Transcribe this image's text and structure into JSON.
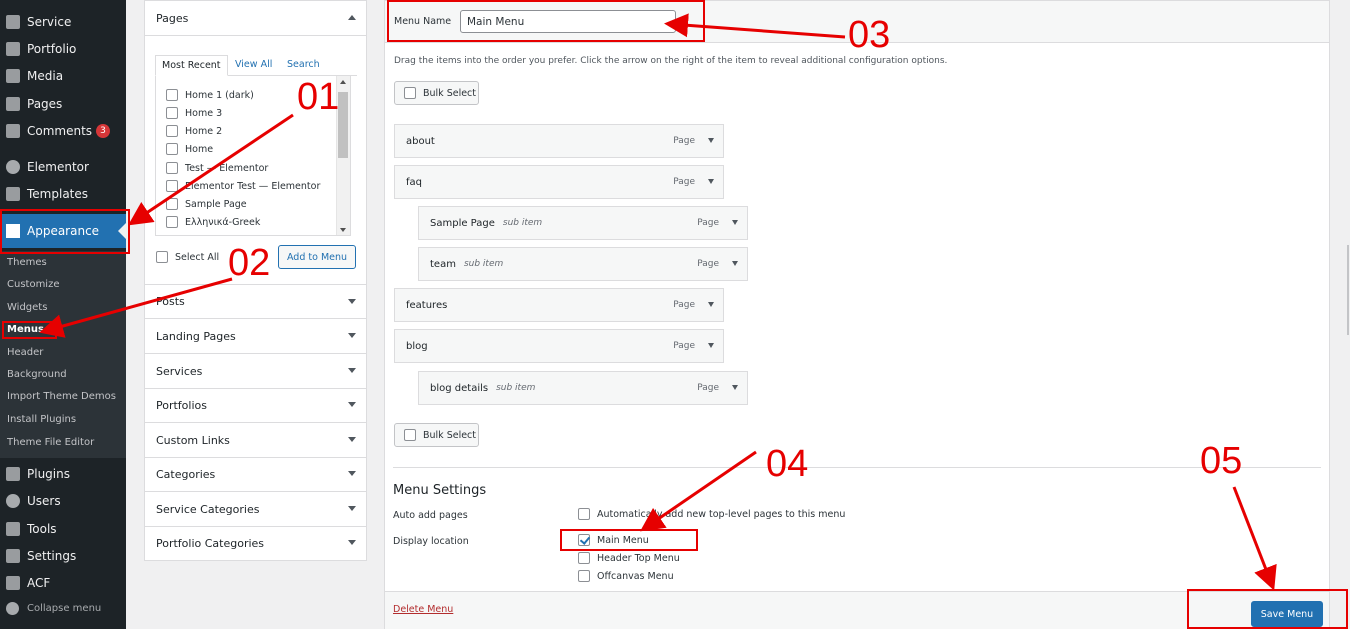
{
  "sidebar": {
    "items": [
      {
        "label": "Service",
        "icon": "shield-icon"
      },
      {
        "label": "Portfolio",
        "icon": "portfolio-icon"
      },
      {
        "label": "Media",
        "icon": "media-icon"
      },
      {
        "label": "Pages",
        "icon": "pages-icon"
      },
      {
        "label": "Comments",
        "icon": "comments-icon",
        "badge": "3"
      },
      {
        "label": "Elementor",
        "icon": "elementor-icon"
      },
      {
        "label": "Templates",
        "icon": "folder-icon"
      },
      {
        "label": "Appearance",
        "icon": "paintbrush-icon"
      },
      {
        "label": "Plugins",
        "icon": "plugin-icon"
      },
      {
        "label": "Users",
        "icon": "users-icon"
      },
      {
        "label": "Tools",
        "icon": "wrench-icon"
      },
      {
        "label": "Settings",
        "icon": "settings-icon"
      },
      {
        "label": "ACF",
        "icon": "acf-icon"
      }
    ],
    "submenu": [
      "Themes",
      "Customize",
      "Widgets",
      "Menus",
      "Header",
      "Background",
      "Import Theme Demos",
      "Install Plugins",
      "Theme File Editor"
    ],
    "collapse_label": "Collapse menu"
  },
  "pages_panel": {
    "title": "Pages",
    "tabs": [
      "Most Recent",
      "View All",
      "Search"
    ],
    "pages": [
      "Home 1 (dark)",
      "Home 3",
      "Home 2",
      "Home",
      "Test — Elementor",
      "Elementor Test — Elementor",
      "Sample Page",
      "Ελληνικά-Greek"
    ],
    "select_all": "Select All",
    "add_to_menu": "Add to Menu"
  },
  "accordion_sections": [
    "Posts",
    "Landing Pages",
    "Services",
    "Portfolios",
    "Custom Links",
    "Categories",
    "Service Categories",
    "Portfolio Categories"
  ],
  "editor": {
    "menu_name_label": "Menu Name",
    "menu_name_value": "Main Menu",
    "instructions": "Drag the items into the order you prefer. Click the arrow on the right of the item to reveal additional configuration options.",
    "bulk_select": "Bulk Select",
    "items": [
      {
        "title": "about",
        "sub": "",
        "type": "Page"
      },
      {
        "title": "faq",
        "sub": "",
        "type": "Page"
      },
      {
        "title": "Sample Page",
        "sub": "sub item",
        "type": "Page"
      },
      {
        "title": "team",
        "sub": "sub item",
        "type": "Page"
      },
      {
        "title": "features",
        "sub": "",
        "type": "Page"
      },
      {
        "title": "blog",
        "sub": "",
        "type": "Page"
      },
      {
        "title": "blog details",
        "sub": "sub item",
        "type": "Page"
      }
    ],
    "settings_title": "Menu Settings",
    "auto_add_label": "Auto add pages",
    "auto_add_text": "Automatically add new top-level pages to this menu",
    "display_location_label": "Display location",
    "locations": [
      {
        "label": "Main Menu",
        "checked": true
      },
      {
        "label": "Header Top Menu",
        "checked": false
      },
      {
        "label": "Offcanvas Menu",
        "checked": false
      }
    ],
    "delete_label": "Delete Menu",
    "save_label": "Save Menu"
  },
  "annotations": [
    "01",
    "02",
    "03",
    "04",
    "05"
  ],
  "colors": {
    "sidebar_bg": "#1d2327",
    "accent": "#2271b1",
    "annotation": "#e60000"
  }
}
